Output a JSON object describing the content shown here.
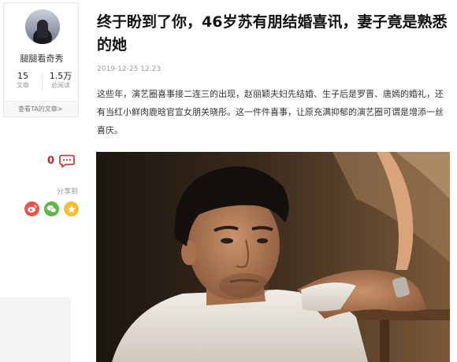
{
  "sidebar": {
    "author_name": "腿腿看奇秀",
    "articles_count": "15",
    "articles_label": "文章",
    "views_count": "1.5万",
    "views_label": "总阅读",
    "view_articles_link": "查看TA的文章>",
    "comment_count": "0",
    "share_label": "分享到",
    "share_icons": [
      "weibo-icon",
      "wechat-icon",
      "qzone-icon"
    ]
  },
  "article": {
    "title": "终于盼到了你，46岁苏有朋结婚喜讯，妻子竟是熟悉的她",
    "timestamp": "2019-12-25 12:23",
    "paragraph": "这些年，演艺圈喜事接二连三的出现，赵丽颖夫妇先结婚、生子后是罗晋、唐嫣的婚礼，还有当红小鲜肉鹿晗官宣女朋关晓彤。这一件件喜事，让原充满抑郁的演艺圈可谓是增添一丝喜庆。"
  },
  "colors": {
    "accent_red": "#c3282a",
    "weibo": "#e8574a",
    "wechat": "#5fb845",
    "qzone": "#f4be2e"
  }
}
